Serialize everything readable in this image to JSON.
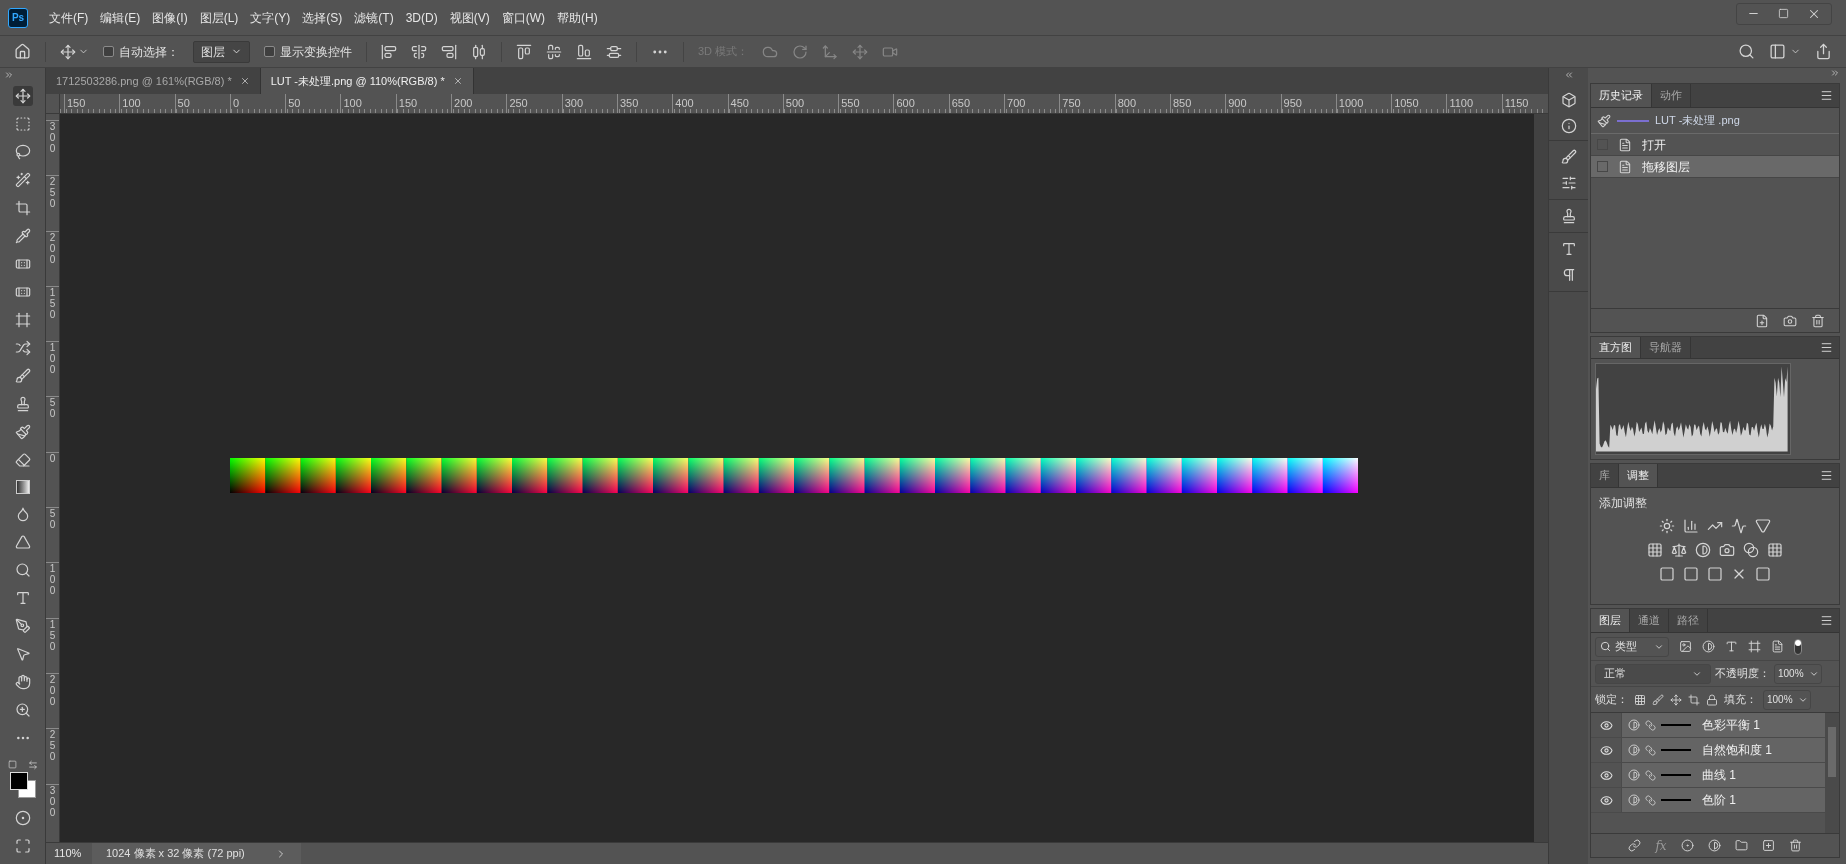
{
  "app_logo": "Ps",
  "menu_bar": {
    "items": [
      "文件(F)",
      "编辑(E)",
      "图像(I)",
      "图层(L)",
      "文字(Y)",
      "选择(S)",
      "滤镜(T)",
      "3D(D)",
      "视图(V)",
      "窗口(W)",
      "帮助(H)"
    ]
  },
  "options_bar": {
    "auto_select": {
      "label": "自动选择：",
      "checked": false
    },
    "target": "图层",
    "show_transform": {
      "label": "显示变换控件",
      "checked": false
    },
    "mode_3d": {
      "label": "3D 模式：",
      "disabled": true
    }
  },
  "document_tabs": [
    {
      "title": "1712503286.png @ 161%(RGB/8) *",
      "selected": false
    },
    {
      "title": "LUT -未处理.png @ 110%(RGB/8) *",
      "selected": true
    }
  ],
  "rulers": {
    "horizontal": [
      "150",
      "100",
      "50",
      "0",
      "50",
      "100",
      "150",
      "200",
      "250",
      "300",
      "350",
      "400",
      "450",
      "500",
      "550",
      "600",
      "650",
      "700",
      "750",
      "800",
      "850",
      "900",
      "950",
      "1000",
      "1050",
      "1100",
      "1150"
    ],
    "vertical": [
      "300",
      "250",
      "200",
      "150",
      "100",
      "50",
      "0",
      "50",
      "100",
      "150",
      "200",
      "250",
      "300"
    ]
  },
  "status_bar": {
    "zoom": "110%",
    "info": "1024 像素 x 32 像素 (72 ppi)"
  },
  "history_panel": {
    "tabs": [
      {
        "label": "历史记录",
        "selected": true
      },
      {
        "label": "动作",
        "selected": false
      }
    ],
    "snapshot": "LUT -未处理 .png",
    "states": [
      {
        "label": "打开",
        "selected": false
      },
      {
        "label": "拖移图层",
        "selected": true
      }
    ]
  },
  "histogram_panel": {
    "tabs": [
      {
        "label": "直方图",
        "selected": true
      },
      {
        "label": "导航器",
        "selected": false
      }
    ]
  },
  "adjustments_panel": {
    "tabs": [
      {
        "label": "库",
        "selected": false
      },
      {
        "label": "调整",
        "selected": true
      }
    ],
    "heading": "添加调整"
  },
  "layers_panel": {
    "tabs": [
      {
        "label": "图层",
        "selected": true
      },
      {
        "label": "通道",
        "selected": false
      },
      {
        "label": "路径",
        "selected": false
      }
    ],
    "filter": "类型",
    "blend_mode": "正常",
    "opacity_label": "不透明度：",
    "opacity": "100%",
    "lock_label": "锁定：",
    "fill_label": "填充：",
    "fill": "100%",
    "layers": [
      {
        "name": "色彩平衡 1",
        "visible": true
      },
      {
        "name": "自然饱和度 1",
        "visible": true
      },
      {
        "name": "曲线 1",
        "visible": true
      },
      {
        "name": "色阶 1",
        "visible": true
      }
    ],
    "fx_label": "fx"
  }
}
